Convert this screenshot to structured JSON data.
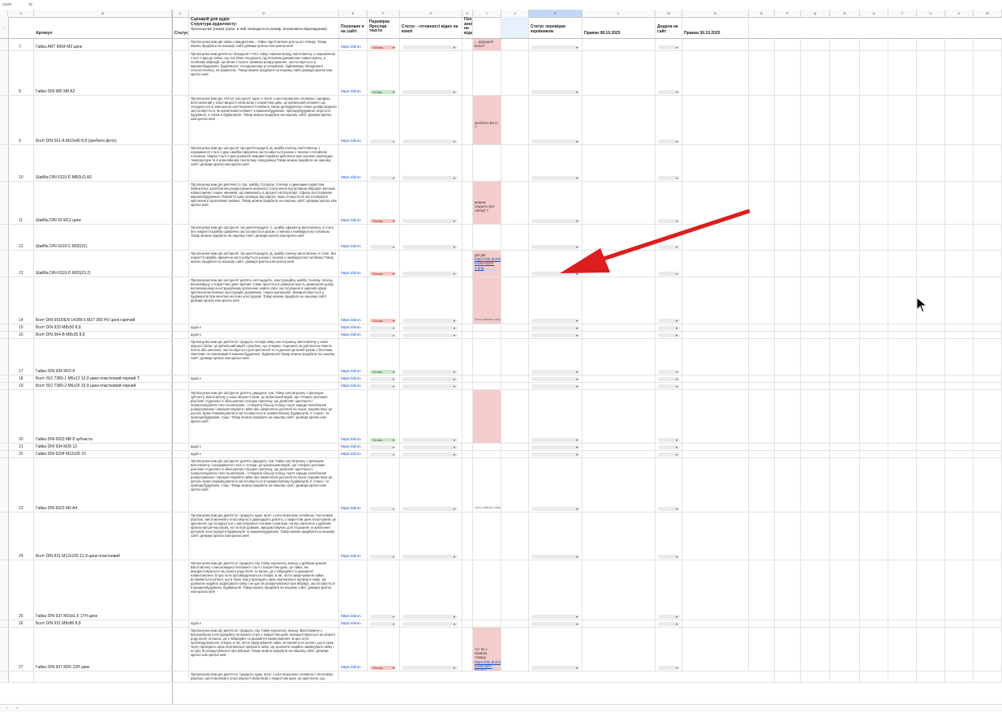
{
  "formula_bar": {
    "cell_ref": "rozm",
    "fx": "fx"
  },
  "columns": [
    "",
    "A",
    "B",
    "C",
    "D",
    "E",
    "F",
    "G",
    "H",
    "I",
    "J",
    "K",
    "L",
    "M",
    "N",
    "O",
    "P",
    "Q",
    "R",
    "S",
    "T",
    "U",
    "V",
    "W",
    "X"
  ],
  "header": {
    "article": "Артикул",
    "status": "Статус",
    "scenario_title": "Сценарій для аудіо",
    "scenario_sub": "Структура аудіотексту:",
    "scenario_note": "Пропонуємо (назва групи, в якій знаходиться розмір, вплаковати відповідника)",
    "link": "Посиланн я на сайті",
    "check": "Перевірка Ярослав тексти",
    "ready": "Статус - готовності відео на компі",
    "posted": "Посил анні на відео",
    "manager": "Статус перевірки керівником",
    "edits1": "Правки 08.10.2025",
    "added": "Додала на сайт",
    "edits2": "Правки 30.10.2025"
  },
  "link_text": "https://dinm",
  "status_labels": {
    "bad": "Погано",
    "ok": "Готово"
  },
  "rows": [
    {
      "n": "7",
      "art": "Гайка ART 9064 M3 цинк",
      "text": "Пропонуємо вам дві гайки з квадратним... Гайка підготовлена для цього отвору. Товар можна придбати на нашому сайті:дінмарк кратка ком кратка юей",
      "chip": "bad",
      "note": "... форкуля вона?"
    },
    {
      "n": "8",
      "art": "Гайка DIN 985 M8 A2",
      "text": "Пропонуємо вам дев'ятсот вісімдесят п'ять гайку самоконтрящу, виготовлену з нержавіючої сталі А два.це гайка, яку постійно поєднують під впливом динамічних навантажень, а особливо вібрацій, що може статися тримкою розкручування. застосовується в машинобудуванні, будівництві, складальному устаткуванні, підйомному обладнанні, сільгосптехніці, інструментах. Товар можна придбати на нашому сайті:дінмарк кратка ком кратка юей",
      "chip": "ok"
    },
    {
      "n": "9",
      "art": "Болт DIN 561-A M10х40 8,8 (зробити фото)",
      "text": "Пропонуємо вам дін п'ятсот шістдесят один А. Болт з шестигранною головкою і цапфою, виготовлений у класі міцності вісім вісім з покриттям цинк. це кріпильний елемент що складається зі зменшеної шестигранної головки в також циліндричного кінця цапфи.Широко застосовується, як кріпильний елемент в машинобудуванні, приладобудуванні, верстато будуванні, а також в будівництві. Товар можна придбати на нашому сайті: дінмарк кратка ком кратка юей",
      "chip": "empty",
      "note": "зробити фото ?"
    },
    {
      "n": "10",
      "art": "Шайба DIN 6319 D M8(9,6) A2",
      "text": "Пропонуємо вам дін шістдесят три дев'ятнадцять Д, шайбу конічну, виготовлену з нержавіючої сталі А два. Шайба сферична застосовується разом з тнином з потайною головкою. Марка сталі А два дозволяє використовувати кріплення при значних перепадах температури та в агресивному і вологому середовищі.Товар можна придбати на нашому сайті: дінмарк кратка ком кратка юей",
      "chip": "empty"
    },
    {
      "n": "11",
      "art": "Шайба DIN 93 M12 цинк",
      "text": "Пропонуємо вам дін дев'яносто три, шайбу стопорну, сталеву з цинковим покриттям. Забезпечує запобігання розкручування нерізного сполучення під впливом вібрацій, високих навантажень і інших чинників, що виникають в процесі експлуатації. Сфера застосування машинобудування. Покриття цинк захищає від корозії, якщо планується застосовувати кріплення в агресивних умовах. Товар можна придбати на нашому сайті: дінмарк кратка ком кратка юей",
      "chip": "bad",
      "note": "можна згадати про лапку) ?"
    },
    {
      "n": "12",
      "art": "Шайба DIN 6319-C M30(31)",
      "text": "Пропонуємо вам дін шістдесят три дев'ятнадцять С, шайбу сферичну виготовлену зі сталі, без покриття.Шайба сферична застосовується разом з тнином з напівкруглою головкою. Товар можна придбати на нашому сайті: дінмарк кратка ком кратка юей",
      "chip": "empty"
    },
    {
      "n": "13",
      "art": "Шайба DIN 6319-D M20(23,2)",
      "text": "Пропонуємо вам дін шістдесят три дев'ятнадцять Д, шайбу конічну виготовлену зі сталі, без покриття.Шайба сферична застосовується разом з тнином з напівкруглою головкою.Товар можна придбати на нашому сайті: дінмарк кратка ком кратка юей",
      "chip": "bad",
      "note": "дін дін",
      "note_link": "https://st0.dnmrk.co m/din-6319-1.png"
    },
    {
      "n": "14",
      "art": "Болт DIN 6916/EN 14399-6 M27 300 HV цинк гарячий",
      "text": "Пропонуємо вам дін шістдесят дев'ять шістнадцять, конструкційну шайбу сталеву, плоску, високоміцну з покриттям цинк гарячий. Самe простота й універсальність дозволили цьому високоміцному конструкційному кріпленню знайти своє застосування в широкій сфері кріплення металевих конструкцій, деревяних і інших матеріалів. Використовується у будівництві при монтажі несучих конструкцій. Товар можна придбати на нашому сайті: дінмарк кратка ком кратка юей",
      "chip": "bad",
      "tiny": "чогось забагато чомусь було ?"
    },
    {
      "n": "15",
      "art": "Болт DIN 933 M8х50 8,8",
      "text": "аудіо є",
      "chip": "empty"
    },
    {
      "n": "16",
      "art": "Болт DIN 564-B M8х35 8,8",
      "text": "аудіо є",
      "chip": "empty"
    },
    {
      "n": "17",
      "art": "Гайка DIN 934 M10 8",
      "text": "Пропонуємо вам дін дев'ятсот тридцять чотири гайку шестигранну, виготовлену у класі міцності вісім. це кріпильний виріб з різьбою, що утворює з'єднання за допомогою гвинта, болта або шпильки. застосовується для кріплення та з'єднання деталей разом з болтами, гвинтами та шпильками в машинобудуванні, будівництві.Товар можна придбати на нашому сайті: дінмарк кратка ком кратка юей",
      "chip": "ok"
    },
    {
      "n": "18",
      "art": "Болт ISO 7380-1 M6х12 10,9 цинк пластковий чорний Т.",
      "text": "аудіо є",
      "chip": "empty"
    },
    {
      "n": "19",
      "art": "Болт ISO 7380-2 M6х20 10,9 цинк пластковий чорний",
      "text": "",
      "chip": "empty"
    },
    {
      "n": "20",
      "art": "Гайка DIN 6923 M8 8 зубчаста",
      "text": "Пропонуємо вам дін шістдесят дев'ять двадцять три, Гайку шестигранну з фланцем зубчасту. Виготовлену у класі міцності вісім. це кріпильний виріб, що створює роз'ємне різьбове з'єднання зі збільшеною площею притиску, що дозволяє одночасно і перерозподілити тиск на матеріал, і створити більшу площу тертя заради запобігання розкручуванню і використовувати гайки при закріпленні деталей на пазах, вздовж яких ця деталь може переміщуватися.застосовується в промисловому будівництві, в станко- та приладобудуванні, тощо. Товар можна придбати на нашому сайті: дінмарк кратка ком кратка юей",
      "chip": "ok"
    },
    {
      "n": "21",
      "art": "Гайка DIN 934 M39 12",
      "text": "аудіо є",
      "chip": "empty"
    },
    {
      "n": "22",
      "art": "Гайка DIN 6334 M12х36 10",
      "text": "аудіо є",
      "chip": "empty"
    },
    {
      "n": "23",
      "art": "Гайка DIN 6923 M6 A4",
      "text": "Пропонуємо вам дін шістдесят дев'ять двадцять три. Гайку шестигранну з фланцем виготовлену з нержавіючої сталі А чотири. це кріпильний виріб, що створює роз'ємне різьбове з'єднання зі збільшеною площею притиску, що дозволяє одночасно і перерозподілити тиск на матеріал, і створити більшу площу тертя заради запобігання розкручуванню і використовувати гайки при закріпленні деталей на пазах, вздовж яких ця деталь може переміщуватися.застосовується в промисловому будівництві, в станко- та приладобудуванні, тощо. Товар можна придбати на нашому сайті: дінмарк кратка ком кратка юей",
      "chip": "empty",
      "tiny": "чогось забагато чомусь було ?"
    },
    {
      "n": "24",
      "art": "Болт DIN 931 M12х100 12,9 цинк пластковий",
      "text": "Пропонуємо вам дін дев'ятсот тридцять один. Болт з шестигранною головкою і частковою різьбою, виготовлений у класі міцності дванадцять дев'ять з покриттям цинк пластковий. це кріплення, що складається з шестигранної головки і шпильки, на яку нанесена з дрібним кроком метрична різьба, не по всій довжині. використовують для з'єднання та кріплення деталей, конструкцій в будівництві та машинобудуванні. Товар можна придбати на нашому сайті: дінмарк кратка ком кратка юей",
      "chip": "empty"
    },
    {
      "n": "25",
      "art": "Гайка DIN 937 M16х1,5 17H цинк",
      "text": "Пропонуємо вам дін дев'ятсот тридцять сім. Гайку корончату низьку з дрібним кроком. Виготовлену з високоміцної легованої сталі з покриттям цинк. це гайки, які використовуються на різного роду вісях та валах, де є вібраційні та динамічні навантаження. В цих осях просвердлюються отвори, в які, після закручування гайки, вставляється шплінт, що в свою чергу проходить крізь вертикальні прорізи в гайці. Це дозволяє надійно зафіксувати гайку і не дає їй розкручуватися при вібрації. застосовується в машинобудуванні, будівництві. Товар можна придбати на нашому сайті: дінмарк кратка ком кратка юей",
      "chip": "empty"
    },
    {
      "n": "26",
      "art": "Болт DIN 931 M8х80 8,8",
      "text": "аудіо є",
      "chip": "empty"
    },
    {
      "n": "27",
      "art": "Гайка DIN 937 M20 22H цинк",
      "text": "Пропонуємо вам дін дев'ятсот тридцять сім. Гайку корончату низьку. Виготовлену з високоміцної конструкційної легованої сталі з покриттям цинк. використовуються на різного роду вісях та валах, де є вібраційні та динамічні навантаження. В цих осях просвердлюються отвори, в які, після закручування гайки, вставляється шплінт, що в свою чергу проходить крізь вертикальні прорізи в гайці. Це дозволяє надійно зафіксувати гайку і не дає їй розкручуватися при вібрації. Товар можна придбати на нашому сайті: дінмарк кратка ком кратка юей",
      "chip": "bad",
      "note": "тут як з назвою товару",
      "note_link": "https://st0.dnmrk.co m/din-937-22.png"
    },
    {
      "n": "",
      "art": "",
      "text": "Пропонуємо вам дін дев'ятсот тридцять один. Болт з шестигранною головкою і частковою різьбою, виготовлений у класі міцності вісім вісім з покриттям цинк. це кріплення, що...",
      "chip": "none"
    }
  ],
  "bottom": {
    "add_sheet": "+",
    "sheets": "≡"
  }
}
